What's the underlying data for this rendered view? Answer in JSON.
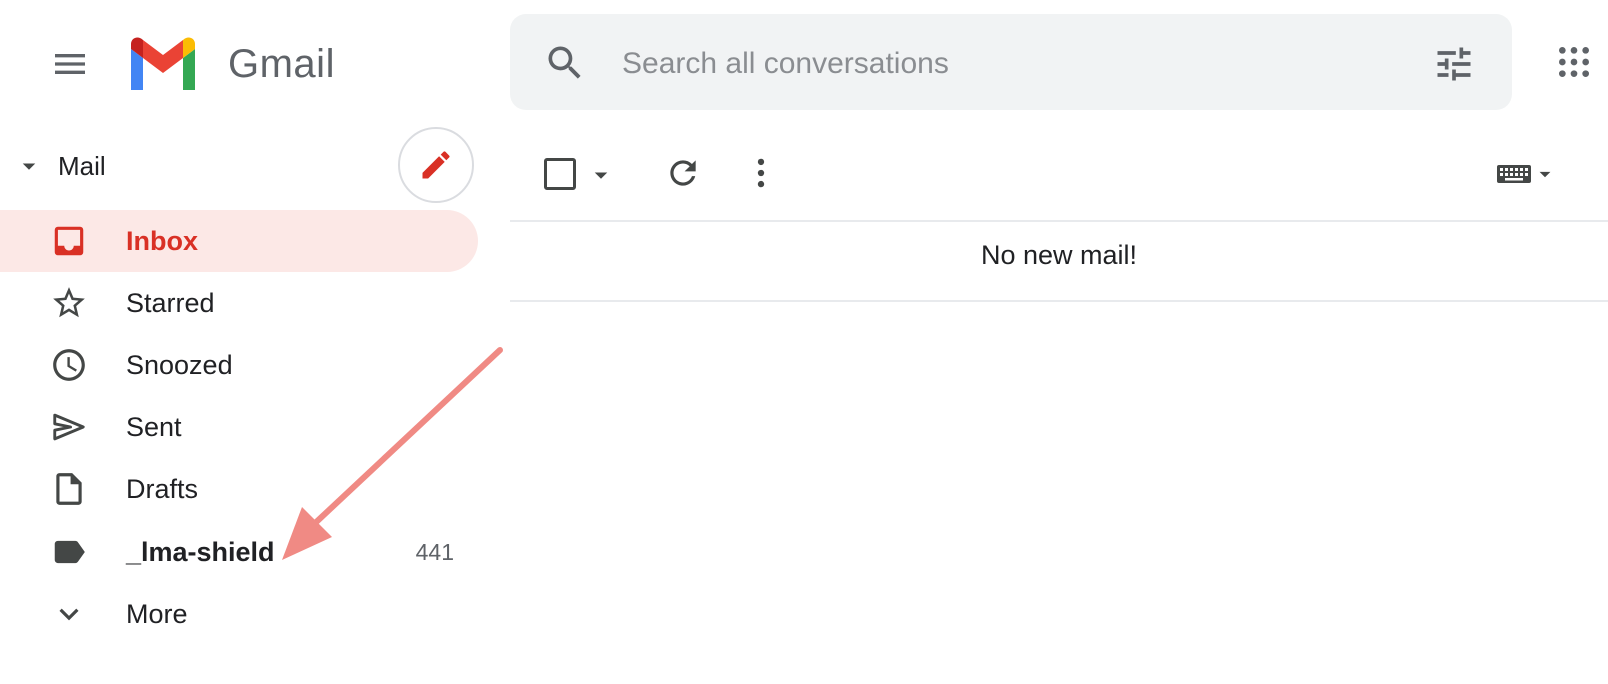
{
  "header": {
    "app_name": "Gmail",
    "search_placeholder": "Search all conversations"
  },
  "sidebar": {
    "section_label": "Mail",
    "items": [
      {
        "label": "Inbox",
        "icon": "inbox-icon",
        "active": true
      },
      {
        "label": "Starred",
        "icon": "star-icon"
      },
      {
        "label": "Snoozed",
        "icon": "clock-icon"
      },
      {
        "label": "Sent",
        "icon": "send-icon"
      },
      {
        "label": "Drafts",
        "icon": "draft-icon"
      },
      {
        "label": "_lma-shield",
        "icon": "label-icon",
        "count": "441",
        "bold": true
      },
      {
        "label": "More",
        "icon": "chevron-down-icon"
      }
    ]
  },
  "main": {
    "empty_message": "No new mail!"
  },
  "colors": {
    "accent": "#d93025",
    "active_bg": "#fce8e6",
    "search_bg": "#f1f3f4",
    "annotation_arrow": "#f08a84"
  }
}
